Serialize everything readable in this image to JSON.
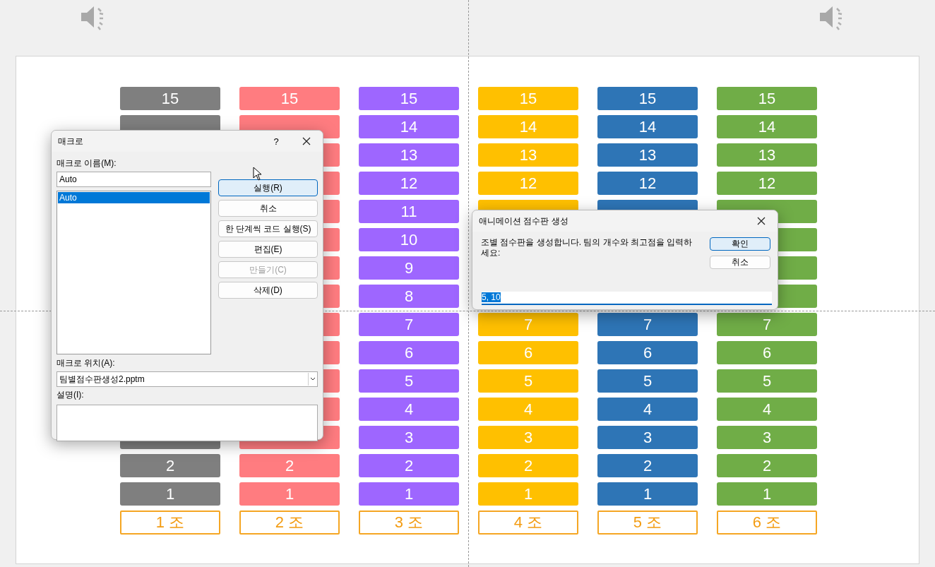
{
  "slide": {
    "columns": [
      {
        "team_label": "1 조",
        "color": "#7f7f7f",
        "cells": [
          {
            "kind": "number",
            "label": "15"
          },
          {
            "kind": "covered"
          },
          {
            "kind": "hidden"
          },
          {
            "kind": "hidden"
          },
          {
            "kind": "hidden"
          },
          {
            "kind": "hidden"
          },
          {
            "kind": "hidden"
          },
          {
            "kind": "hidden"
          },
          {
            "kind": "hidden"
          },
          {
            "kind": "hidden"
          },
          {
            "kind": "hidden"
          },
          {
            "kind": "hidden"
          },
          {
            "kind": "covered"
          },
          {
            "kind": "number",
            "label": "2"
          },
          {
            "kind": "number",
            "label": "1"
          }
        ]
      },
      {
        "team_label": "2 조",
        "color": "#ff7c80",
        "cells": [
          {
            "kind": "number",
            "label": "15"
          },
          {
            "kind": "covered"
          },
          {
            "kind": "covered"
          },
          {
            "kind": "covered"
          },
          {
            "kind": "covered"
          },
          {
            "kind": "covered"
          },
          {
            "kind": "covered"
          },
          {
            "kind": "covered"
          },
          {
            "kind": "covered"
          },
          {
            "kind": "covered"
          },
          {
            "kind": "covered"
          },
          {
            "kind": "covered"
          },
          {
            "kind": "covered"
          },
          {
            "kind": "number",
            "label": "2"
          },
          {
            "kind": "number",
            "label": "1"
          }
        ]
      },
      {
        "team_label": "3 조",
        "color": "#9e66ff",
        "cells": [
          {
            "kind": "number",
            "label": "15"
          },
          {
            "kind": "number",
            "label": "14"
          },
          {
            "kind": "number",
            "label": "13"
          },
          {
            "kind": "number",
            "label": "12"
          },
          {
            "kind": "number",
            "label": "11"
          },
          {
            "kind": "number",
            "label": "10"
          },
          {
            "kind": "number",
            "label": "9"
          },
          {
            "kind": "number",
            "label": "8"
          },
          {
            "kind": "number",
            "label": "7"
          },
          {
            "kind": "number",
            "label": "6"
          },
          {
            "kind": "number",
            "label": "5"
          },
          {
            "kind": "number",
            "label": "4"
          },
          {
            "kind": "number",
            "label": "3"
          },
          {
            "kind": "number",
            "label": "2"
          },
          {
            "kind": "number",
            "label": "1"
          }
        ]
      },
      {
        "team_label": "4 조",
        "color": "#ffc000",
        "cells": [
          {
            "kind": "number",
            "label": "15"
          },
          {
            "kind": "number",
            "label": "14"
          },
          {
            "kind": "number",
            "label": "13"
          },
          {
            "kind": "number",
            "label": "12"
          },
          {
            "kind": "covered"
          },
          {
            "kind": "covered"
          },
          {
            "kind": "covered"
          },
          {
            "kind": "covered"
          },
          {
            "kind": "number",
            "label": "7"
          },
          {
            "kind": "number",
            "label": "6"
          },
          {
            "kind": "number",
            "label": "5"
          },
          {
            "kind": "number",
            "label": "4"
          },
          {
            "kind": "number",
            "label": "3"
          },
          {
            "kind": "number",
            "label": "2"
          },
          {
            "kind": "number",
            "label": "1"
          }
        ]
      },
      {
        "team_label": "5 조",
        "color": "#2e75b6",
        "cells": [
          {
            "kind": "number",
            "label": "15"
          },
          {
            "kind": "number",
            "label": "14"
          },
          {
            "kind": "number",
            "label": "13"
          },
          {
            "kind": "number",
            "label": "12"
          },
          {
            "kind": "covered"
          },
          {
            "kind": "covered"
          },
          {
            "kind": "covered"
          },
          {
            "kind": "covered"
          },
          {
            "kind": "number",
            "label": "7"
          },
          {
            "kind": "number",
            "label": "6"
          },
          {
            "kind": "number",
            "label": "5"
          },
          {
            "kind": "number",
            "label": "4"
          },
          {
            "kind": "number",
            "label": "3"
          },
          {
            "kind": "number",
            "label": "2"
          },
          {
            "kind": "number",
            "label": "1"
          }
        ]
      },
      {
        "team_label": "6 조",
        "color": "#70ad47",
        "cells": [
          {
            "kind": "number",
            "label": "15"
          },
          {
            "kind": "number",
            "label": "14"
          },
          {
            "kind": "number",
            "label": "13"
          },
          {
            "kind": "number",
            "label": "12"
          },
          {
            "kind": "covered"
          },
          {
            "kind": "covered"
          },
          {
            "kind": "covered"
          },
          {
            "kind": "covered"
          },
          {
            "kind": "number",
            "label": "7"
          },
          {
            "kind": "number",
            "label": "6"
          },
          {
            "kind": "number",
            "label": "5"
          },
          {
            "kind": "number",
            "label": "4"
          },
          {
            "kind": "number",
            "label": "3"
          },
          {
            "kind": "number",
            "label": "2"
          },
          {
            "kind": "number",
            "label": "1"
          }
        ]
      }
    ]
  },
  "macro_dialog": {
    "title": "매크로",
    "help": "?",
    "name_label": "매크로 이름(M):",
    "name_value": "Auto",
    "macros": [
      {
        "label": "Auto",
        "selected": true
      }
    ],
    "buttons": [
      {
        "label": "실행(R)",
        "default": true,
        "disabled": false
      },
      {
        "label": "취소",
        "default": false,
        "disabled": false
      },
      {
        "label": "한 단계씩 코드 실행(S)",
        "default": false,
        "disabled": false
      },
      {
        "label": "편집(E)",
        "default": false,
        "disabled": false
      },
      {
        "label": "만들기(C)",
        "default": false,
        "disabled": true
      },
      {
        "label": "삭제(D)",
        "default": false,
        "disabled": false
      }
    ],
    "location_label": "매크로 위치(A):",
    "location_value": "팀별점수판생성2.pptm",
    "description_label": "설명(I):"
  },
  "input_dialog": {
    "title": "애니메이션 점수판 생성",
    "message": "조별 점수판을 생성합니다. 팀의 개수와 최고점을 입력하세요:",
    "buttons": [
      {
        "label": "확인",
        "default": true
      },
      {
        "label": "취소",
        "default": false
      }
    ],
    "value": "5, 10",
    "value_selected": true
  }
}
